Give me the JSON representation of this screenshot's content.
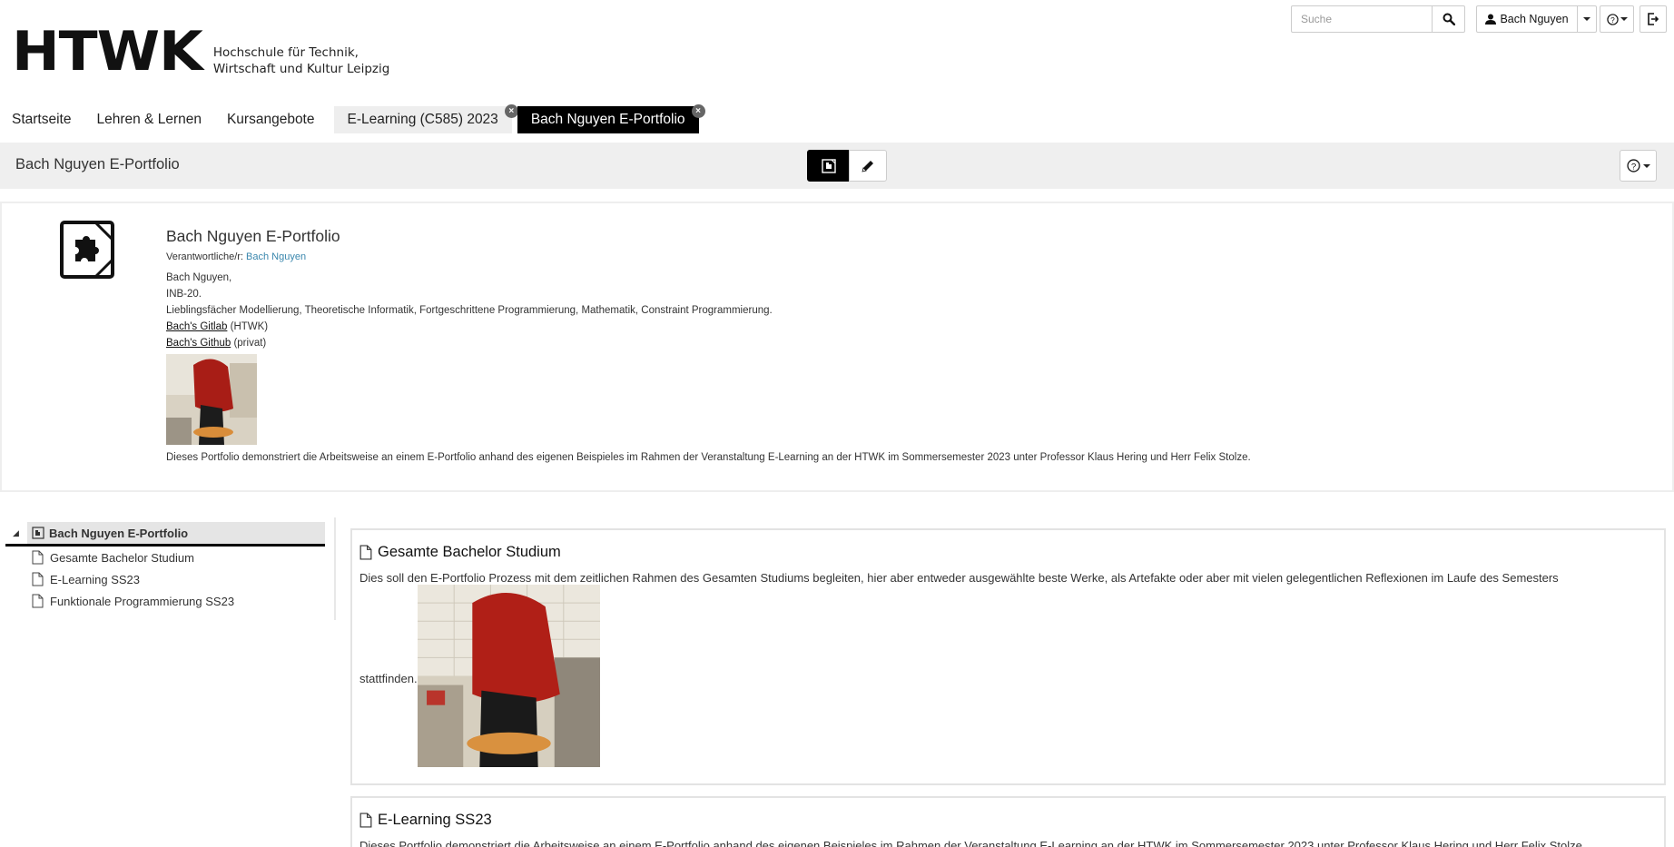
{
  "header": {
    "logo_mark": "HTWK",
    "logo_line1": "Hochschule für Technik,",
    "logo_line2": "Wirtschaft und Kultur Leipzig",
    "search_placeholder": "Suche",
    "user_name": "Bach Nguyen"
  },
  "nav": {
    "items": [
      {
        "label": "Startseite"
      },
      {
        "label": "Lehren & Lernen"
      },
      {
        "label": "Kursangebote"
      }
    ],
    "tabs": [
      {
        "label": "E-Learning (C585) 2023",
        "active": false
      },
      {
        "label": "Bach Nguyen E-Portfolio",
        "active": true
      }
    ]
  },
  "toolbar": {
    "title": "Bach Nguyen E-Portfolio"
  },
  "info": {
    "title": "Bach Nguyen E-Portfolio",
    "responsible_label": "Verantwortliche/r:",
    "responsible_name": "Bach Nguyen",
    "line1": "Bach Nguyen,",
    "line2": "INB-20.",
    "line3": "Lieblingsfächer Modellierung, Theoretische Informatik, Fortgeschrittene Programmierung, Mathematik, Constraint Programmierung.",
    "gitlab_link": "Bach's Gitlab",
    "gitlab_suffix": "(HTWK)",
    "github_link": "Bach's Github",
    "github_suffix": "(privat)",
    "description": "Dieses Portfolio demonstriert die Arbeitsweise an einem E-Portfolio anhand des eigenen Beispieles im Rahmen der Veranstaltung E-Learning an der HTWK im Sommersemester 2023 unter Professor Klaus Hering und Herr Felix Stolze."
  },
  "tree": {
    "root": "Bach Nguyen E-Portfolio",
    "items": [
      {
        "label": "Gesamte Bachelor Studium"
      },
      {
        "label": "E-Learning SS23"
      },
      {
        "label": "Funktionale Programmierung SS23"
      }
    ]
  },
  "cards": [
    {
      "title": "Gesamte Bachelor Studium",
      "text": "Dies soll den E-Portfolio Prozess mit dem zeitlichen Rahmen des Gesamten Studiums begleiten, hier aber entweder ausgewählte beste Werke, als Artefakte oder aber mit vielen gelegentlichen Reflexionen im Laufe des Semesters",
      "text_end": "stattfinden."
    },
    {
      "title": "E-Learning SS23",
      "text": "Dieses Portfolio demonstriert die Arbeitsweise an einem E-Portfolio anhand des eigenen Beispieles im Rahmen der Veranstaltung E-Learning an der HTWK im Sommersemester 2023 unter Professor Klaus Hering und Herr Felix Stolze."
    }
  ],
  "colors": {
    "accent_link": "#3a87ad",
    "active_tab_bg": "#000000",
    "toolbar_bg": "#efefef"
  }
}
